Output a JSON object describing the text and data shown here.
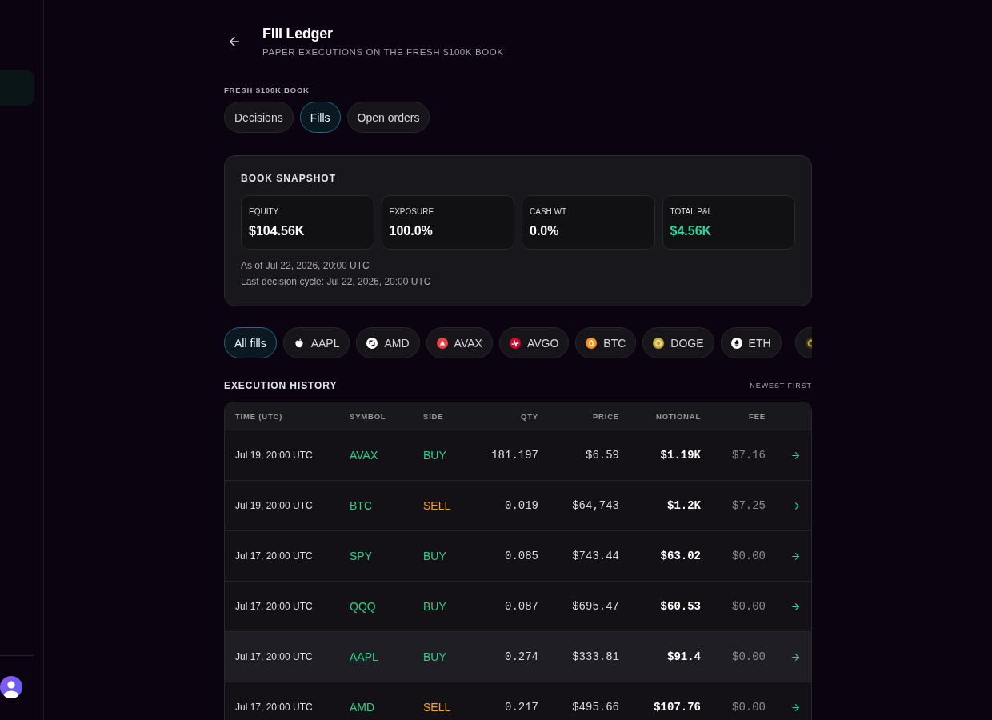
{
  "sidebar": {
    "items": [
      {
        "selected": true
      }
    ]
  },
  "header": {
    "title": "Fill Ledger",
    "subtitle": "PAPER EXECUTIONS ON THE FRESH $100K BOOK"
  },
  "book_label": "FRESH $100K BOOK",
  "tabs": [
    {
      "label": "Decisions",
      "selected": false
    },
    {
      "label": "Fills",
      "selected": true
    },
    {
      "label": "Open orders",
      "selected": false
    }
  ],
  "snapshot": {
    "title": "BOOK SNAPSHOT",
    "stats": [
      {
        "label": "EQUITY",
        "value": "$104.56K",
        "color": "#ffffff"
      },
      {
        "label": "EXPOSURE",
        "value": "100.0%",
        "color": "#ffffff"
      },
      {
        "label": "CASH WT",
        "value": "0.0%",
        "color": "#ffffff"
      },
      {
        "label": "TOTAL P&L",
        "value": "$4.56K",
        "color": "#34d39a"
      }
    ],
    "as_of": "As of Jul 22, 2026, 20:00 UTC",
    "last_cycle": "Last decision cycle: Jul 22, 2026, 20:00 UTC"
  },
  "filters": [
    {
      "label": "All fills",
      "selected": true
    },
    {
      "label": "AAPL",
      "kind": "apple",
      "selected": false
    },
    {
      "label": "AMD",
      "kind": "square",
      "selected": false
    },
    {
      "label": "AVAX",
      "kind": "triangle",
      "selected": false
    },
    {
      "label": "AVGO",
      "kind": "wave",
      "selected": false
    },
    {
      "label": "BTC",
      "kind": "orange",
      "selected": false
    },
    {
      "label": "DOGE",
      "kind": "gold",
      "selected": false
    },
    {
      "label": "ETH",
      "kind": "diamond",
      "selected": false
    },
    {
      "kind": "dark",
      "selected": false
    }
  ],
  "history": {
    "title": "EXECUTION HISTORY",
    "sort": "NEWEST FIRST",
    "columns": [
      "TIME (UTC)",
      "SYMBOL",
      "SIDE",
      "QTY",
      "PRICE",
      "NOTIONAL",
      "FEE"
    ],
    "rows": [
      {
        "time": "Jul 19, 20:00 UTC",
        "symbol": "AVAX",
        "side": {
          "label": "BUY",
          "color": "#2fcf8b"
        },
        "qty": "181.197",
        "price": "$6.59",
        "notional": "$1.19K",
        "fee": "$7.16",
        "selected": false
      },
      {
        "time": "Jul 19, 20:00 UTC",
        "symbol": "BTC",
        "side": {
          "label": "SELL",
          "color": "#f3a51b"
        },
        "qty": "0.019",
        "price": "$64,743",
        "notional": "$1.2K",
        "fee": "$7.25",
        "selected": false
      },
      {
        "time": "Jul 17, 20:00 UTC",
        "symbol": "SPY",
        "side": {
          "label": "BUY",
          "color": "#2fcf8b"
        },
        "qty": "0.085",
        "price": "$743.44",
        "notional": "$63.02",
        "fee": "$0.00",
        "selected": false
      },
      {
        "time": "Jul 17, 20:00 UTC",
        "symbol": "QQQ",
        "side": {
          "label": "BUY",
          "color": "#2fcf8b"
        },
        "qty": "0.087",
        "price": "$695.47",
        "notional": "$60.53",
        "fee": "$0.00",
        "selected": false
      },
      {
        "time": "Jul 17, 20:00 UTC",
        "symbol": "AAPL",
        "side": {
          "label": "BUY",
          "color": "#2fcf8b"
        },
        "qty": "0.274",
        "price": "$333.81",
        "notional": "$91.4",
        "fee": "$0.00",
        "selected": true
      },
      {
        "time": "Jul 17, 20:00 UTC",
        "symbol": "AMD",
        "side": {
          "label": "SELL",
          "color": "#f3a51b"
        },
        "qty": "0.217",
        "price": "$495.66",
        "notional": "$107.76",
        "fee": "$0.00",
        "selected": false
      }
    ]
  }
}
